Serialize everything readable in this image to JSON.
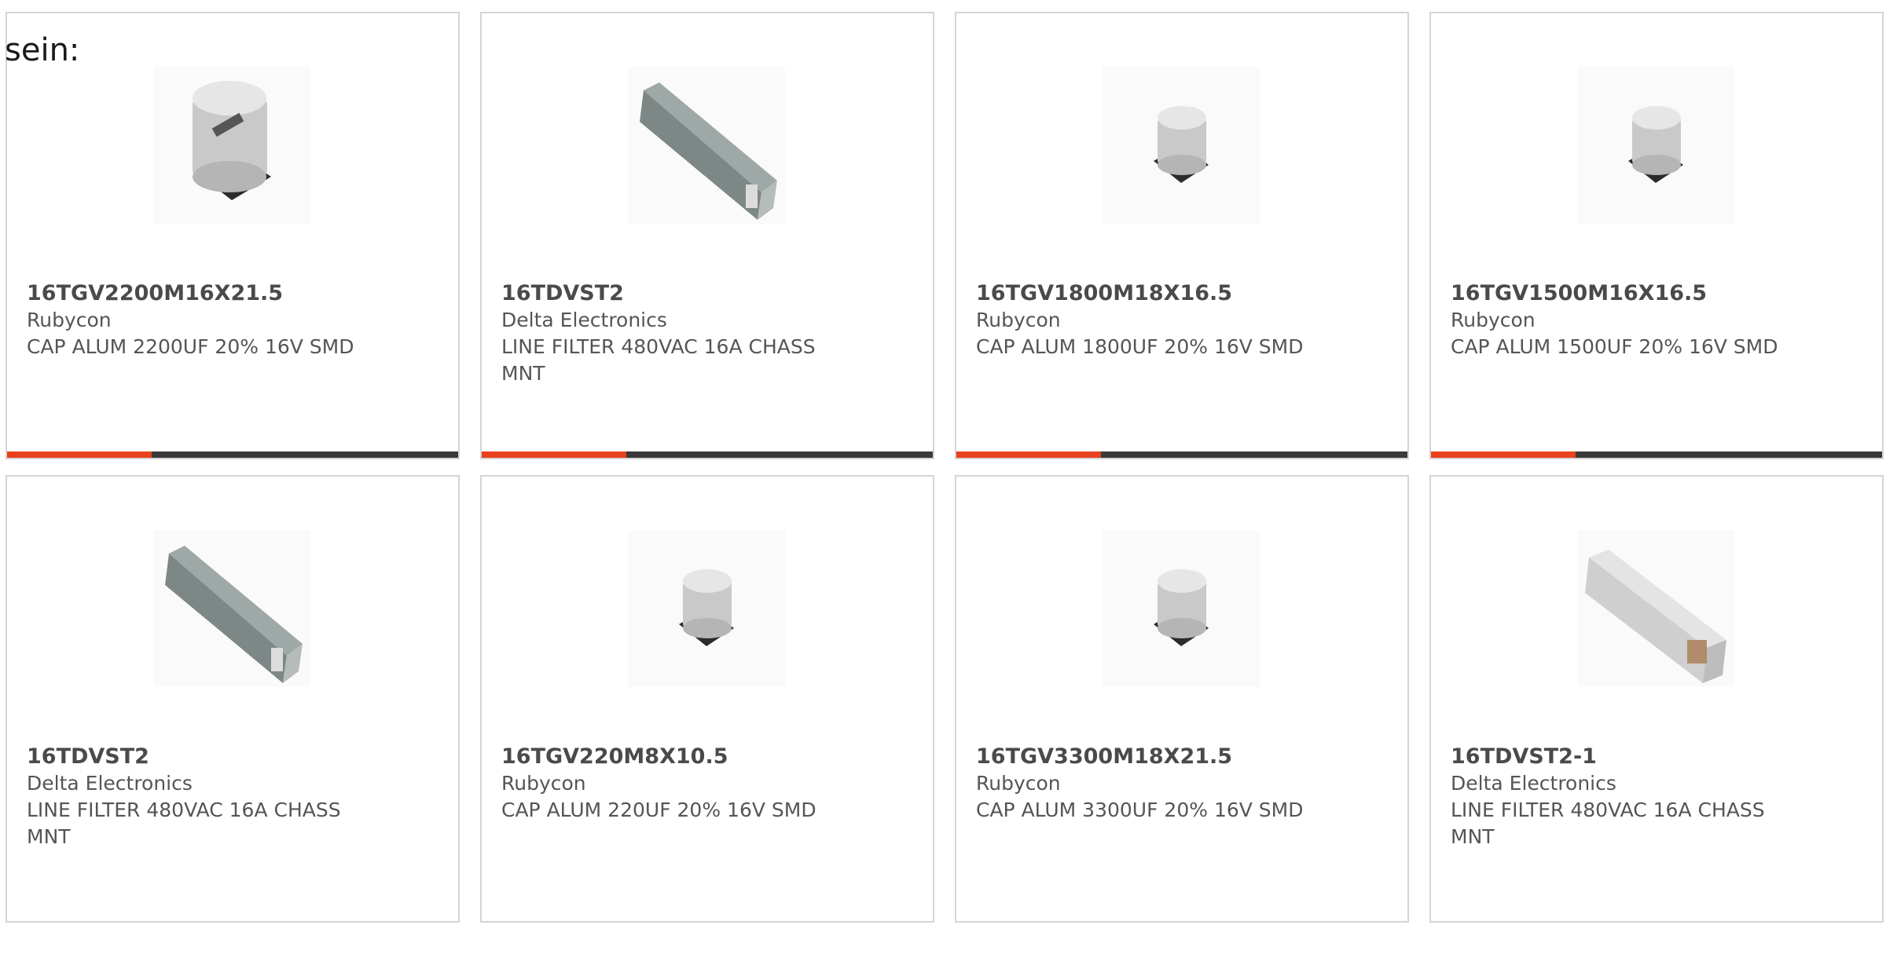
{
  "intro_text": "sein:",
  "accent_color": "#e8411e",
  "bar_color": "#3a3a3a",
  "products": [
    {
      "part": "16TGV2200M16X21.5",
      "maker": "Rubycon",
      "desc": "CAP ALUM 2200UF 20% 16V SMD",
      "image": "capacitor-large-icon"
    },
    {
      "part": "16TDVST2",
      "maker": "Delta Electronics",
      "desc": "LINE FILTER 480VAC 16A CHASS MNT",
      "image": "line-filter-icon"
    },
    {
      "part": "16TGV1800M18X16.5",
      "maker": "Rubycon",
      "desc": "CAP ALUM 1800UF 20% 16V SMD",
      "image": "capacitor-small-icon"
    },
    {
      "part": "16TGV1500M16X16.5",
      "maker": "Rubycon",
      "desc": "CAP ALUM 1500UF 20% 16V SMD",
      "image": "capacitor-small-icon"
    },
    {
      "part": "16TDVST2",
      "maker": "Delta Electronics",
      "desc": "LINE FILTER 480VAC 16A CHASS MNT",
      "image": "line-filter-icon"
    },
    {
      "part": "16TGV220M8X10.5",
      "maker": "Rubycon",
      "desc": "CAP ALUM 220UF 20% 16V SMD",
      "image": "capacitor-small-icon"
    },
    {
      "part": "16TGV3300M18X21.5",
      "maker": "Rubycon",
      "desc": "CAP ALUM 3300UF 20% 16V SMD",
      "image": "capacitor-small-icon"
    },
    {
      "part": "16TDVST2-1",
      "maker": "Delta Electronics",
      "desc": "LINE FILTER 480VAC 16A CHASS MNT",
      "image": "line-filter-white-icon"
    }
  ]
}
